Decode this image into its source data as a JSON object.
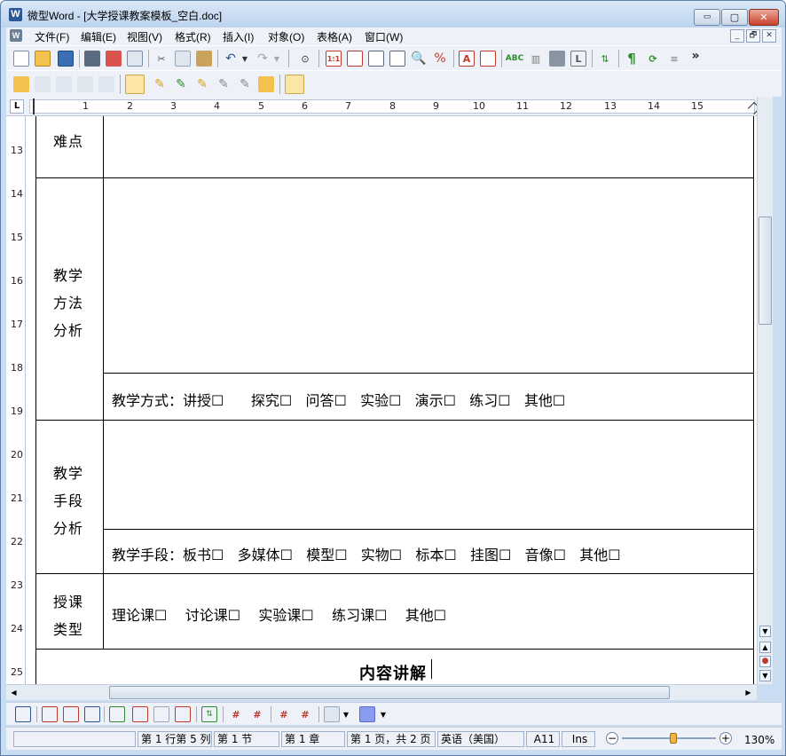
{
  "window": {
    "title": "微型Word - [大学授课教案模板_空白.doc]",
    "app_icon_letter": "W",
    "controls": {
      "minimize": "▭",
      "maximize": "▢",
      "close": "✕"
    }
  },
  "menu": {
    "items": [
      "文件(F)",
      "编辑(E)",
      "视图(V)",
      "格式(R)",
      "插入(I)",
      "对象(O)",
      "表格(A)",
      "窗口(W)"
    ],
    "mdi_controls": [
      "_",
      "🗗",
      "✕"
    ]
  },
  "toolbar_overflow": "»",
  "ruler": {
    "numbers": [
      "1",
      "2",
      "3",
      "4",
      "5",
      "6",
      "7",
      "8",
      "9",
      "10",
      "11",
      "12",
      "13",
      "14",
      "15"
    ],
    "vertical_numbers": [
      "13",
      "14",
      "15",
      "16",
      "17",
      "18",
      "19",
      "20",
      "21",
      "22",
      "23",
      "24",
      "25"
    ],
    "tab_marker": "L"
  },
  "document": {
    "rows": {
      "difficulty": {
        "label": "难点"
      },
      "method": {
        "label_lines": [
          "教学",
          "方法",
          "分析"
        ],
        "options": "教学方式：讲授☐      探究☐   问答☐   实验☐   演示☐   练习☐   其他☐"
      },
      "means": {
        "label_lines": [
          "教学",
          "手段",
          "分析"
        ],
        "options": "教学手段：板书☐   多媒体☐   模型☐   实物☐   标本☐   挂图☐   音像☐   其他☐"
      },
      "lesson_type": {
        "label_lines": [
          "授课",
          "类型"
        ],
        "options": "理论课☐    讨论课☐    实验课☐    练习课☐    其他☐"
      },
      "content": {
        "title": "内容讲解"
      }
    }
  },
  "statusbar": {
    "position": "第 1 行第 5 列",
    "section": "第 1 节",
    "chapter": "第 1 章",
    "page": "第 1 页，共 2 页",
    "language": "英语（美国）",
    "cell": "A11",
    "mode": "Ins",
    "zoom": "130%",
    "zoom_level": 0.55
  },
  "colors": {
    "accent": "#2b5797",
    "frame": "#c9dcf2",
    "toolbar": "#eef2f8"
  }
}
